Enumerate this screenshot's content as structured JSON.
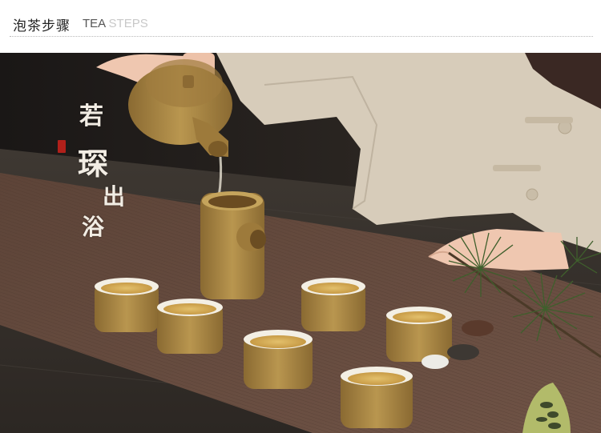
{
  "header": {
    "title_cn": "泡茶步骤",
    "title_en_part1": "TEA",
    "title_en_part2": "STEPS"
  },
  "photo": {
    "calligraphy": [
      "若",
      "琛",
      "出",
      "浴"
    ]
  },
  "colors": {
    "background_dark": "#24201c",
    "table_wood": "#3a3430",
    "mat": "#6a4e42",
    "pottery": "#a98748",
    "tea": "#d8b25e",
    "linen": "#d8cebd",
    "seal_red": "#b1201a"
  }
}
